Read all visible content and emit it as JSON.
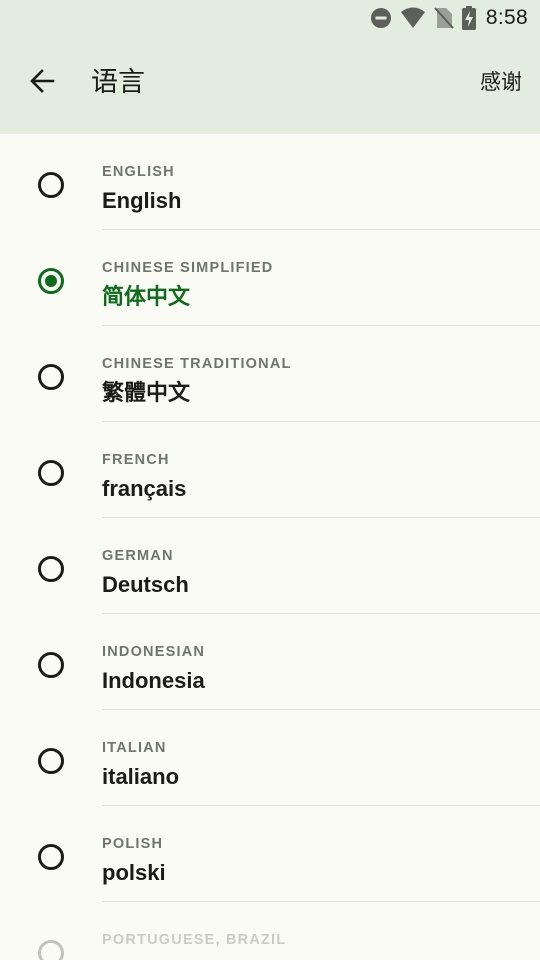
{
  "status_bar": {
    "time": "8:58",
    "icons": [
      "dnd-icon",
      "wifi-icon",
      "no-sim-icon",
      "battery-charging-icon"
    ]
  },
  "app_bar": {
    "back_icon": "arrow-back-icon",
    "title": "语言",
    "action_label": "感谢"
  },
  "colors": {
    "accent": "#0f6b1c",
    "app_bar_background": "#e2ecdf",
    "page_background": "#fafbf4"
  },
  "languages": [
    {
      "caption": "ENGLISH",
      "name": "English",
      "selected": false
    },
    {
      "caption": "CHINESE SIMPLIFIED",
      "name": "简体中文",
      "selected": true
    },
    {
      "caption": "CHINESE TRADITIONAL",
      "name": "繁體中文",
      "selected": false
    },
    {
      "caption": "FRENCH",
      "name": "français",
      "selected": false
    },
    {
      "caption": "GERMAN",
      "name": "Deutsch",
      "selected": false
    },
    {
      "caption": "INDONESIAN",
      "name": "Indonesia",
      "selected": false
    },
    {
      "caption": "ITALIAN",
      "name": "italiano",
      "selected": false
    },
    {
      "caption": "POLISH",
      "name": "polski",
      "selected": false
    },
    {
      "caption": "PORTUGUESE, BRAZIL",
      "selected": false
    }
  ]
}
